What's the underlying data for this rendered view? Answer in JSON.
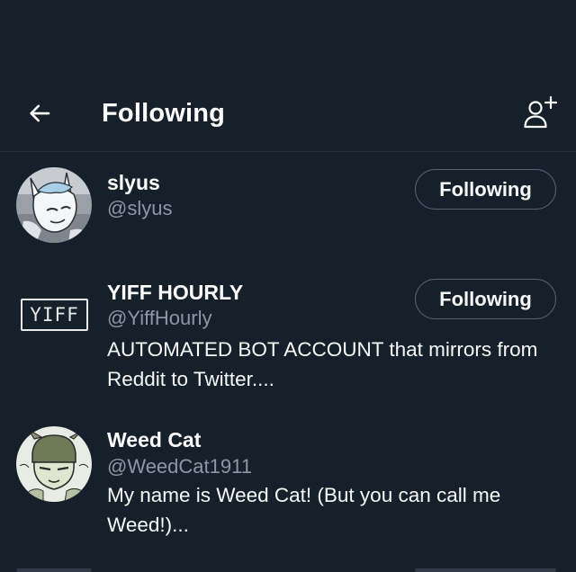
{
  "header": {
    "title": "Following",
    "back_icon": "arrow-left-icon",
    "add_icon": "person-plus-icon"
  },
  "users": [
    {
      "name": "slyus",
      "handle": "@slyus",
      "bio": "",
      "button": "Following"
    },
    {
      "name": "YIFF HOURLY",
      "handle": "@YiffHourly",
      "bio": "AUTOMATED BOT ACCOUNT that mirrors from Reddit to Twitter....",
      "button": "Following",
      "logo_text": "YIFF"
    },
    {
      "name": "Weed Cat",
      "handle": "@WeedCat1911",
      "bio": "My name is Weed Cat! (But you can call me Weed!)...",
      "button": ""
    }
  ],
  "colors": {
    "background": "#15202b",
    "text": "#ffffff",
    "secondary": "#8b98a5",
    "button_border": "#536471"
  }
}
